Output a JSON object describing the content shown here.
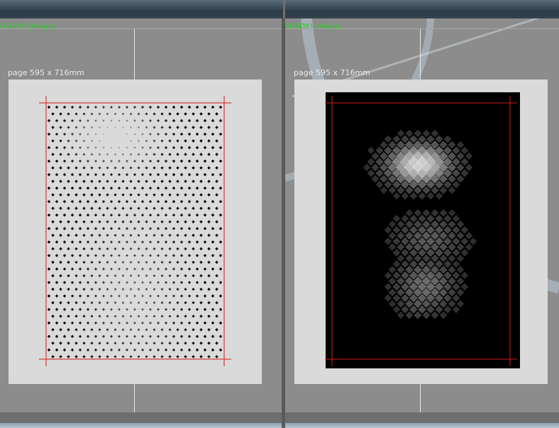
{
  "viewports": [
    {
      "status": "READY! (Mega)",
      "page_size": "page 595 x 716mm",
      "content": "dot-halftone"
    },
    {
      "status": "READY! (Mega)",
      "page_size": "page 595 x 716mm",
      "content": "negative-diamond-halftone"
    }
  ],
  "colors": {
    "status_text": "#1fd41f",
    "crop_marks": "#d31a1a",
    "sheet": "#dadada",
    "workspace": "#8c8c8c"
  }
}
